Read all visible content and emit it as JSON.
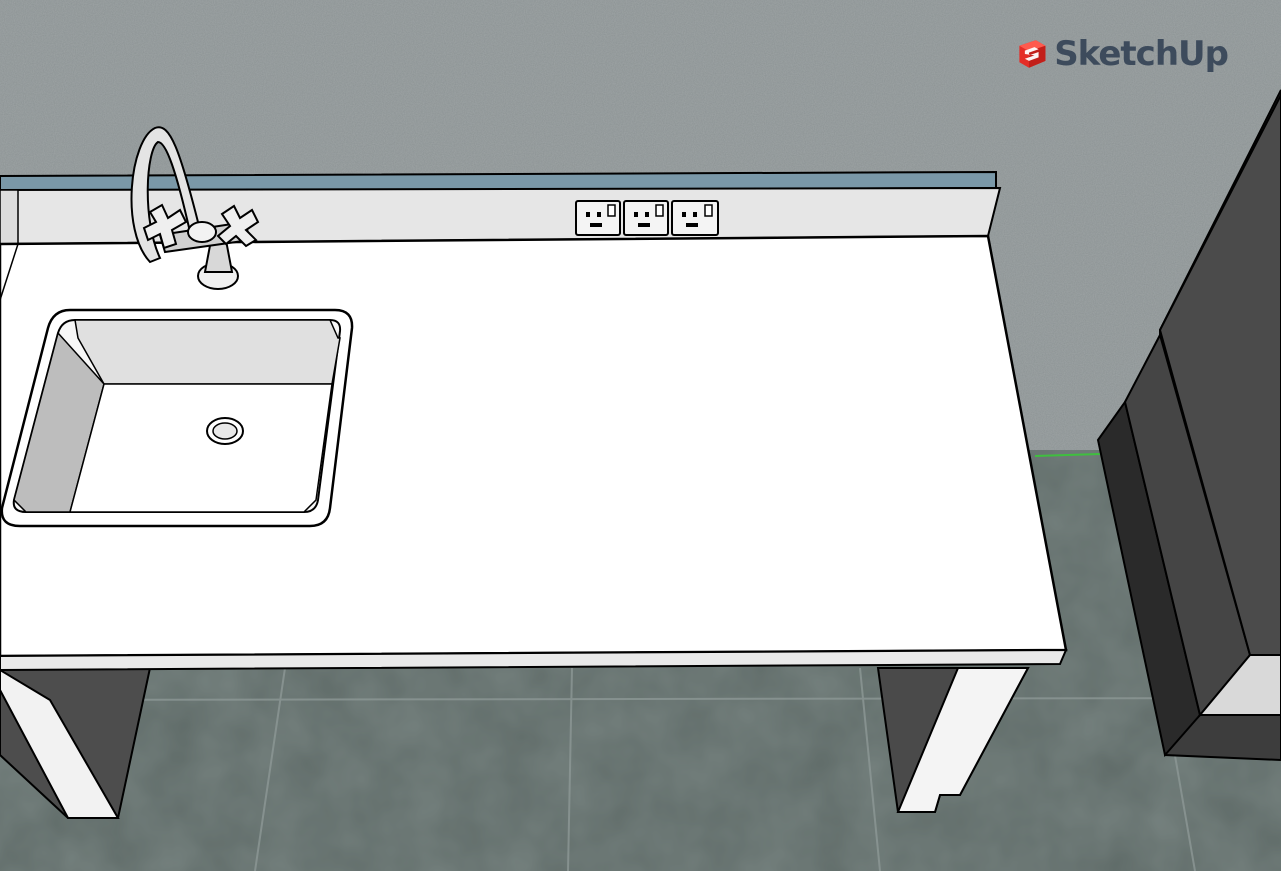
{
  "app": {
    "brand": "SketchUp",
    "logo_icon": "sketchup-logo-icon"
  },
  "scene": {
    "description_tags": [
      "kitchen-counter",
      "sink",
      "mixer-tap",
      "wall-sockets",
      "floor-tiles",
      "cabinet"
    ],
    "colors": {
      "wall": "#8b9293",
      "floor": "#5f6b68",
      "countertop": "#ffffff",
      "backsplash": "#e6e6e6",
      "cabinet": "#4a4a4a",
      "splashback_edge": "#7a98a8",
      "logo_red": "#e52d27",
      "logo_text": "#3d4b5c"
    },
    "socket_count": 3
  }
}
